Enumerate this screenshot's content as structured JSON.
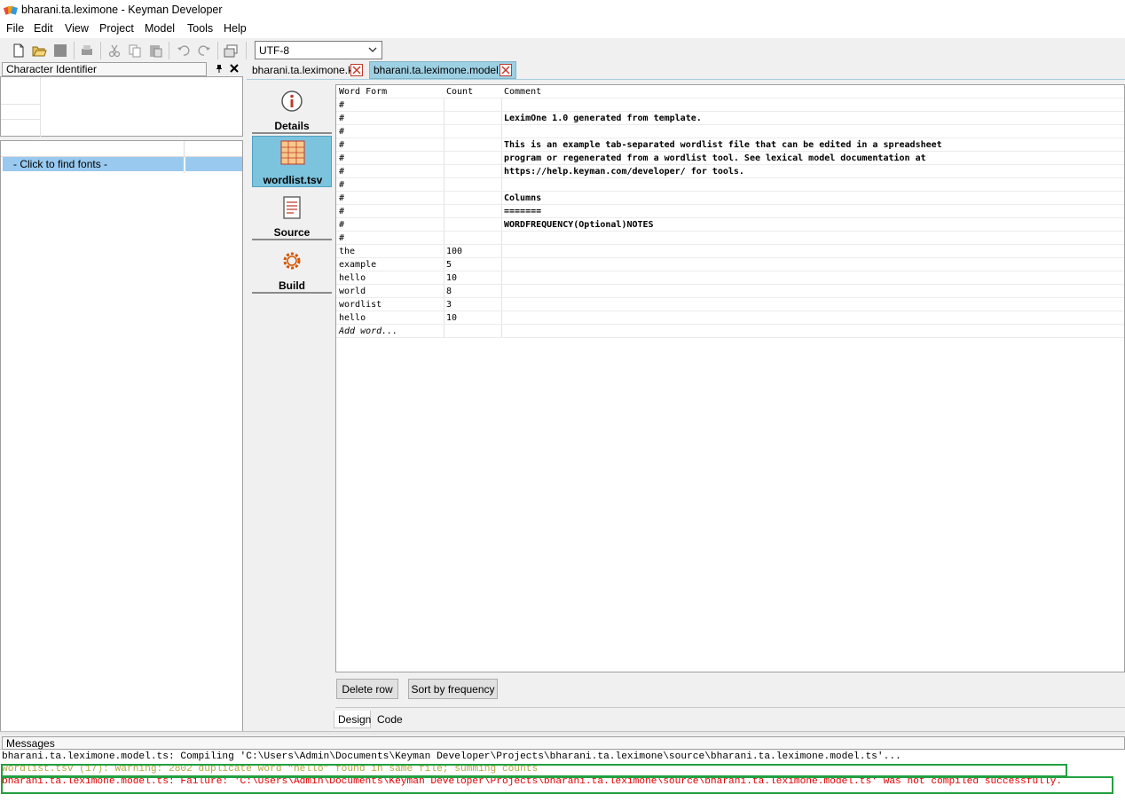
{
  "window": {
    "title": "bharani.ta.leximone - Keyman Developer"
  },
  "menu": [
    "File",
    "Edit",
    "View",
    "Project",
    "Model",
    "Tools",
    "Help"
  ],
  "toolbar": {
    "encoding": "UTF-8"
  },
  "char_panel": {
    "title": "Character Identifier",
    "font_row": "- Click to find fonts -"
  },
  "tabs": [
    {
      "label": "bharani.ta.leximone.kpj"
    },
    {
      "label": "bharani.ta.leximone.model.ts"
    }
  ],
  "side_nav": [
    {
      "label": "Details",
      "icon": "info-icon"
    },
    {
      "label": "wordlist.tsv",
      "icon": "spreadsheet-icon"
    },
    {
      "label": "Source",
      "icon": "document-icon"
    },
    {
      "label": "Build",
      "icon": "gear-icon"
    }
  ],
  "grid": {
    "headers": [
      "Word Form",
      "Count",
      "Comment"
    ],
    "rows": [
      [
        "#",
        "",
        ""
      ],
      [
        "#",
        "",
        "LeximOne 1.0 generated from template."
      ],
      [
        "#",
        "",
        ""
      ],
      [
        "#",
        "",
        "This is an example tab-separated wordlist file that can be edited in a spreadsheet"
      ],
      [
        "#",
        "",
        "program or regenerated from a wordlist tool. See lexical model documentation at"
      ],
      [
        "#",
        "",
        "https://help.keyman.com/developer/ for tools."
      ],
      [
        "#",
        "",
        ""
      ],
      [
        "#",
        "",
        "Columns"
      ],
      [
        "#",
        "",
        "======="
      ],
      [
        "#",
        "",
        "WORDFREQUENCY(Optional)NOTES"
      ],
      [
        "#",
        "",
        ""
      ],
      [
        "the",
        "100",
        ""
      ],
      [
        "example",
        "5",
        ""
      ],
      [
        "hello",
        "10",
        ""
      ],
      [
        "world",
        "8",
        ""
      ],
      [
        "wordlist",
        "3",
        ""
      ],
      [
        "hello",
        "10",
        ""
      ]
    ],
    "add_word": "Add word..."
  },
  "buttons": {
    "delete_row": "Delete row",
    "sort": "Sort by frequency"
  },
  "modes": {
    "design": "Design",
    "code": "Code"
  },
  "messages": {
    "title": "Messages",
    "compiling": "bharani.ta.leximone.model.ts: Compiling 'C:\\Users\\Admin\\Documents\\Keyman Developer\\Projects\\bharani.ta.leximone\\source\\bharani.ta.leximone.model.ts'...",
    "warning": "wordlist.tsv (17): Warning: 2802 duplicate word “hello” found in same file; summing counts",
    "failure": "bharani.ta.leximone.model.ts: Failure: 'C:\\Users\\Admin\\Documents\\Keyman Developer\\Projects\\bharani.ta.leximone\\source\\bharani.ta.leximone.model.ts' was not compiled successfully."
  },
  "colors": {
    "active_tab": "#9ed0e3",
    "selected_nav": "#7cc3dd",
    "warning_text": "#b5a642",
    "failure_text": "#e00000",
    "highlight_box": "#22a040"
  }
}
